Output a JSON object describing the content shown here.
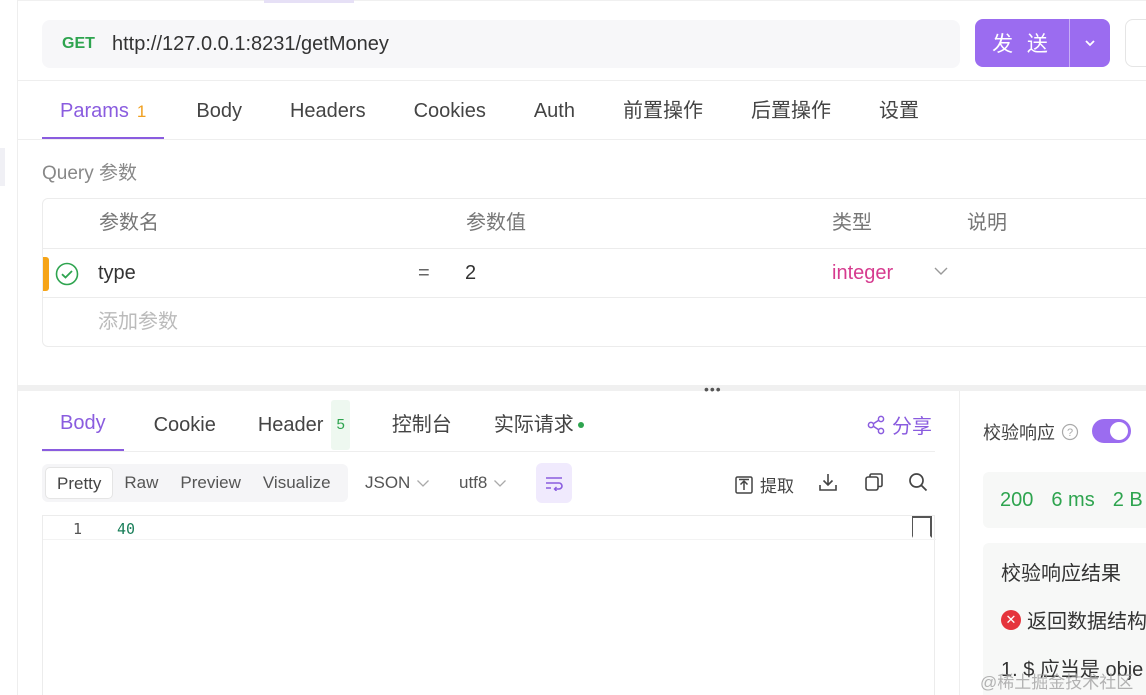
{
  "request": {
    "method": "GET",
    "url": "http://127.0.0.1:8231/getMoney",
    "send_label": "发 送"
  },
  "request_tabs": [
    {
      "label": "Params",
      "badge": "1",
      "active": true
    },
    {
      "label": "Body"
    },
    {
      "label": "Headers"
    },
    {
      "label": "Cookies"
    },
    {
      "label": "Auth"
    },
    {
      "label": "前置操作"
    },
    {
      "label": "后置操作"
    },
    {
      "label": "设置"
    }
  ],
  "query": {
    "section_label": "Query 参数",
    "columns": [
      "参数名",
      "参数值",
      "类型",
      "说明"
    ],
    "rows": [
      {
        "name": "type",
        "operator": "=",
        "value": "2",
        "type": "integer",
        "enabled": true
      }
    ],
    "add_placeholder": "添加参数"
  },
  "response_tabs": [
    {
      "label": "Body",
      "active": true
    },
    {
      "label": "Cookie"
    },
    {
      "label": "Header",
      "badge": "5"
    },
    {
      "label": "控制台"
    },
    {
      "label": "实际请求",
      "dot": true
    }
  ],
  "share_label": "分享",
  "format_options": [
    "Pretty",
    "Raw",
    "Preview",
    "Visualize"
  ],
  "format_selected": "Pretty",
  "language_select": "JSON",
  "encoding_select": "utf8",
  "tools": {
    "extract_label": "提取"
  },
  "editor": {
    "line_number": "1",
    "content": "40"
  },
  "verify": {
    "label": "校验响应",
    "enabled": true
  },
  "status": {
    "code": "200",
    "time": "6 ms",
    "size": "2 B"
  },
  "result": {
    "title": "校验响应结果",
    "error": "返回数据结构",
    "detail": "1. $ 应当是 obje"
  },
  "watermark": "@稀土掘金技术社区",
  "colors": {
    "accent": "#9b6cf0",
    "method_get": "#2ea44f",
    "type_value": "#d63b8f",
    "param_badge": "#f0a020",
    "error": "#e5343c"
  }
}
